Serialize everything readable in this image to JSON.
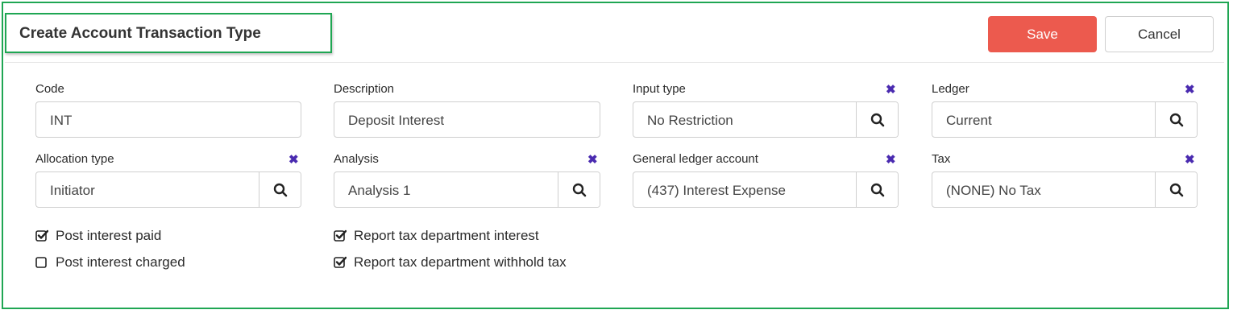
{
  "header": {
    "title": "Create Account Transaction Type",
    "save_label": "Save",
    "cancel_label": "Cancel"
  },
  "fields": {
    "code": {
      "label": "Code",
      "value": "INT"
    },
    "description": {
      "label": "Description",
      "value": "Deposit Interest"
    },
    "input_type": {
      "label": "Input type",
      "value": "No Restriction",
      "clear_icon": "close-x-icon",
      "lookup_icon": "search-icon"
    },
    "ledger": {
      "label": "Ledger",
      "value": "Current",
      "clear_icon": "close-x-icon",
      "lookup_icon": "search-icon"
    },
    "allocation_type": {
      "label": "Allocation type",
      "value": "Initiator",
      "clear_icon": "close-x-icon",
      "lookup_icon": "search-icon"
    },
    "analysis": {
      "label": "Analysis",
      "value": "Analysis 1",
      "clear_icon": "close-x-icon",
      "lookup_icon": "search-icon"
    },
    "general_ledger_account": {
      "label": "General ledger account",
      "value": "(437) Interest Expense",
      "clear_icon": "close-x-icon",
      "lookup_icon": "search-icon"
    },
    "tax": {
      "label": "Tax",
      "value": "(NONE) No Tax",
      "clear_icon": "close-x-icon",
      "lookup_icon": "search-icon"
    }
  },
  "checkboxes": {
    "post_interest_paid": {
      "label": "Post interest paid",
      "checked": true
    },
    "post_interest_charged": {
      "label": "Post interest charged",
      "checked": false
    },
    "report_tax_department_interest": {
      "label": "Report tax department interest",
      "checked": true
    },
    "report_tax_department_withhold_tax": {
      "label": "Report tax department withhold tax",
      "checked": true
    }
  },
  "colors": {
    "highlight_border": "#1fa653",
    "save_button": "#ec5a4e",
    "clear_icon": "#4a2bb0"
  }
}
